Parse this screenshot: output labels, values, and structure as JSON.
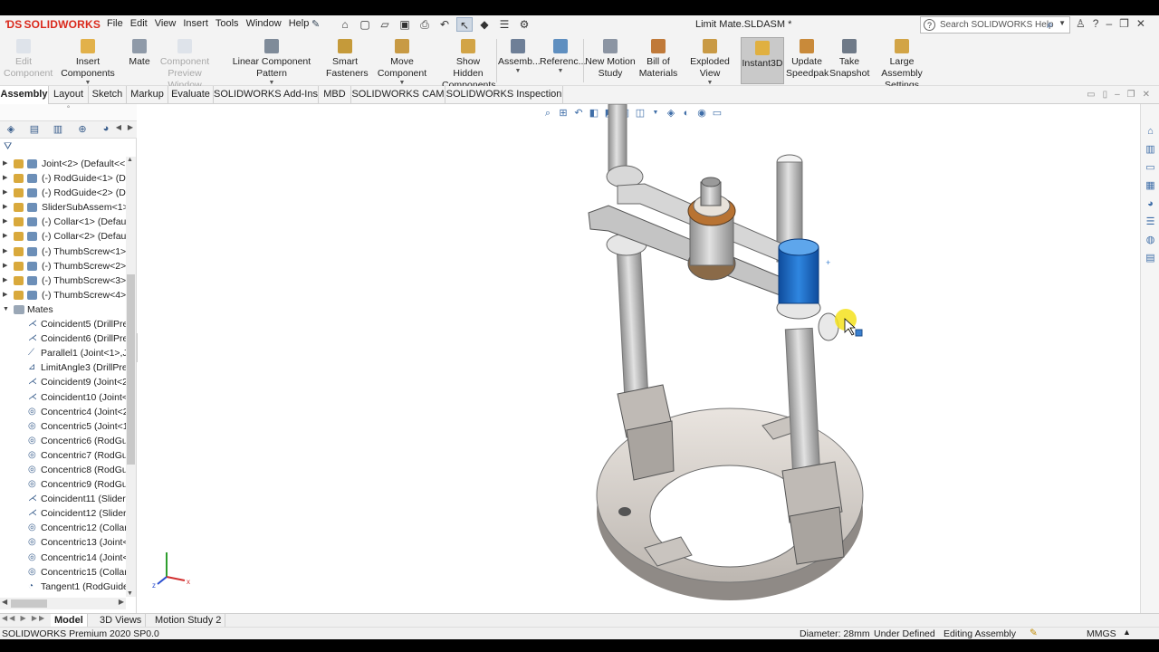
{
  "app": {
    "logo": "SOLIDWORKS",
    "menu": [
      "File",
      "Edit",
      "View",
      "Insert",
      "Tools",
      "Window",
      "Help"
    ],
    "document_title": "Limit Mate.SLDASM *",
    "search_placeholder": "Search SOLIDWORKS Help"
  },
  "ribbon": {
    "buttons": [
      {
        "label": "Edit Component",
        "enabled": false
      },
      {
        "label": "Insert Components",
        "enabled": true
      },
      {
        "label": "Mate",
        "enabled": true
      },
      {
        "label": "Component Preview Window",
        "enabled": false
      },
      {
        "label": "Linear Component Pattern",
        "enabled": true
      },
      {
        "label": "Smart Fasteners",
        "enabled": true
      },
      {
        "label": "Move Component",
        "enabled": true
      },
      {
        "label": "Show Hidden Components",
        "enabled": true
      },
      {
        "label": "Assemb...",
        "enabled": true
      },
      {
        "label": "Referenc...",
        "enabled": true
      },
      {
        "label": "New Motion Study",
        "enabled": true
      },
      {
        "label": "Bill of Materials",
        "enabled": true
      },
      {
        "label": "Exploded View",
        "enabled": true
      },
      {
        "label": "Instant3D",
        "enabled": true,
        "active": true
      },
      {
        "label": "Update Speedpak",
        "enabled": true
      },
      {
        "label": "Take Snapshot",
        "enabled": true
      },
      {
        "label": "Large Assembly Settings",
        "enabled": true
      }
    ]
  },
  "command_tabs": [
    "Assembly",
    "Layout",
    "Sketch",
    "Markup",
    "Evaluate",
    "SOLIDWORKS Add-Ins",
    "MBD",
    "SOLIDWORKS CAM",
    "SOLIDWORKS Inspection"
  ],
  "tree": {
    "components": [
      "Joint<2> (Default<<",
      "(-) RodGuide<1> (D",
      "(-) RodGuide<2> (D",
      "SliderSubAssem<1>",
      "(-) Collar<1> (Defau",
      "(-) Collar<2> (Defau",
      "(-) ThumbScrew<1>",
      "(-) ThumbScrew<2>",
      "(-) ThumbScrew<3>",
      "(-) ThumbScrew<4>"
    ],
    "mates_label": "Mates",
    "mates": [
      {
        "label": "Coincident5 (DrillPre",
        "icon": "coincident"
      },
      {
        "label": "Coincident6 (DrillPre",
        "icon": "coincident"
      },
      {
        "label": "Parallel1 (Joint<1>,Jo",
        "icon": "parallel"
      },
      {
        "label": "LimitAngle3 (DrillPre",
        "icon": "limitangle"
      },
      {
        "label": "Coincident9 (Joint<2",
        "icon": "coincident"
      },
      {
        "label": "Coincident10 (Joint<",
        "icon": "coincident"
      },
      {
        "label": "Concentric4 (Joint<2",
        "icon": "concentric"
      },
      {
        "label": "Concentric5 (Joint<1",
        "icon": "concentric"
      },
      {
        "label": "Concentric6 (RodGui",
        "icon": "concentric"
      },
      {
        "label": "Concentric7 (RodGui",
        "icon": "concentric"
      },
      {
        "label": "Concentric8 (RodGui",
        "icon": "concentric"
      },
      {
        "label": "Concentric9 (RodGui",
        "icon": "concentric"
      },
      {
        "label": "Coincident11 (Slider",
        "icon": "coincident"
      },
      {
        "label": "Coincident12 (Slider",
        "icon": "coincident"
      },
      {
        "label": "Concentric12 (Collar",
        "icon": "concentric"
      },
      {
        "label": "Concentric13 (Joint<",
        "icon": "concentric"
      },
      {
        "label": "Concentric14 (Joint<",
        "icon": "concentric"
      },
      {
        "label": "Concentric15 (Collar",
        "icon": "concentric"
      },
      {
        "label": "Tangent1 (RodGuide",
        "icon": "tangent"
      }
    ]
  },
  "bottom_tabs": [
    "Model",
    "3D Views",
    "Motion Study 2"
  ],
  "status": {
    "version": "SOLIDWORKS Premium 2020 SP0.0",
    "selection": "Diameter: 28mm",
    "state": "Under Defined",
    "mode": "Editing Assembly",
    "units": "MMGS"
  },
  "colors": {
    "brand": "#da291c",
    "selection": "#1f63b8",
    "accent": "#3f6ea8"
  }
}
